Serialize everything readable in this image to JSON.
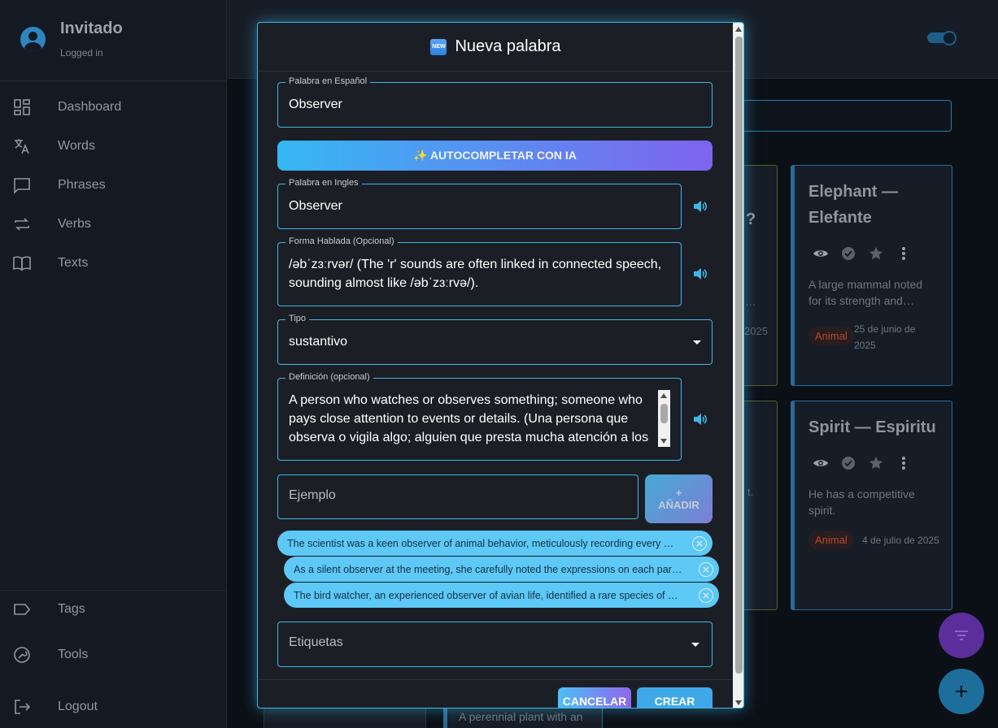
{
  "sidebar": {
    "profile": {
      "name": "Invitado",
      "status": "Logged in"
    },
    "items": [
      {
        "label": "Dashboard",
        "icon": "dashboard-icon"
      },
      {
        "label": "Words",
        "icon": "translate-icon"
      },
      {
        "label": "Phrases",
        "icon": "chat-icon"
      },
      {
        "label": "Verbs",
        "icon": "repeat-icon"
      },
      {
        "label": "Texts",
        "icon": "book-icon"
      }
    ],
    "bottom_items": [
      {
        "label": "Tags",
        "icon": "tag-icon"
      },
      {
        "label": "Tools",
        "icon": "wrench-icon"
      },
      {
        "label": "Logout",
        "icon": "logout-icon"
      }
    ]
  },
  "cards": [
    {
      "title": "Elephant — Elefante",
      "description": "A large mammal noted for its strength and…",
      "tag": "Animal",
      "date": "25 de junio de 2025"
    },
    {
      "title": "Spirit — Espiritu",
      "description": "He has a competitive spirit.",
      "tag": "Animal",
      "date": "4 de julio de 2025"
    }
  ],
  "partial_cards": {
    "top_question": "?",
    "top_ellipsis": "?) …",
    "top_year": "2025",
    "mid_text": "t.",
    "bottom_text": "A perennial plant with an"
  },
  "dialog": {
    "title": "Nueva palabra",
    "badge": "NEW",
    "spanish_word": {
      "label": "Palabra en Español",
      "value": "Observer"
    },
    "ai_button": "✨ AUTOCOMPLETAR CON IA",
    "english_word": {
      "label": "Palabra en Ingles",
      "value": "Observer"
    },
    "spoken_form": {
      "label": "Forma Hablada (Opcional)",
      "line1": "/əbˈzɜːrvər/  (The 'r' sounds are often linked in connected speech,",
      "line2": "sounding almost like /əbˈzɜːrvə/)."
    },
    "type": {
      "label": "Tipo",
      "value": "sustantivo"
    },
    "definition": {
      "label": "Definición (opcional)",
      "line1": "A person who watches or observes something; someone who",
      "line2": "pays close attention to events or details. (Una persona que",
      "line3": "observa o vigila algo; alguien que presta mucha atención a los"
    },
    "example": {
      "placeholder": "Ejemplo"
    },
    "add_button": {
      "plus": "+",
      "label": "AÑADIR"
    },
    "examples": [
      "The scientist was a keen observer of animal behavior, meticulously recording every …",
      "As a silent observer at the meeting, she carefully noted the expressions on each par…",
      "The bird watcher, an experienced observer of avian life, identified a rare species of …"
    ],
    "tags": {
      "placeholder": "Etiquetas"
    },
    "cancel_label": "CANCELAR",
    "create_label": "CREAR"
  },
  "colors": {
    "accent": "#3fb6e6",
    "gradient_start": "#35b8f3",
    "gradient_end": "#7f63ee",
    "chip": "#5ec8f6",
    "tag_text": "#b3492f"
  }
}
